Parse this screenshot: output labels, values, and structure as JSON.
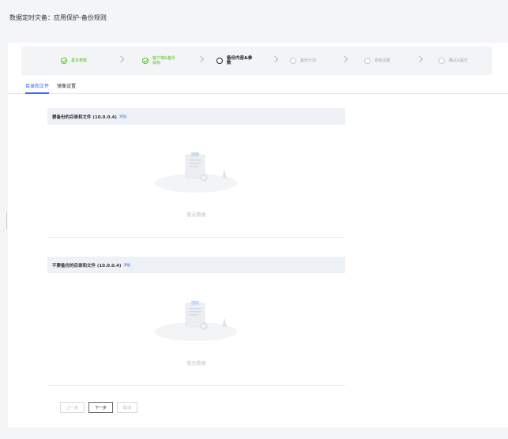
{
  "header": {
    "title": "数据定时灾备：应用保护-备份规则"
  },
  "steps": [
    {
      "label": "基本参数",
      "state": "done"
    },
    {
      "label": "客户端&备份\n目标",
      "state": "done"
    },
    {
      "label": "备份内容&参\n数",
      "state": "current"
    },
    {
      "label": "备份计划",
      "state": "pending"
    },
    {
      "label": "高级设置",
      "state": "pending"
    },
    {
      "label": "确认&提交",
      "state": "pending"
    }
  ],
  "tabs": [
    {
      "label": "目录和文件",
      "active": true
    },
    {
      "label": "镜像设置",
      "active": false
    }
  ],
  "include_section": {
    "title": "要备份的目录和文件 (10.0.0.4)",
    "add_label": "添加",
    "empty_text": "暂无数据"
  },
  "exclude_section": {
    "title": "不要备份的目录和文件 (10.0.0.4)",
    "add_label": "添加",
    "empty_text": "暂无数据"
  },
  "buttons": {
    "prev": "上一步",
    "next": "下一步",
    "cancel": "取消"
  },
  "colors": {
    "accent": "#2f6bff",
    "success": "#52c41a",
    "background": "#f4f5f7"
  }
}
